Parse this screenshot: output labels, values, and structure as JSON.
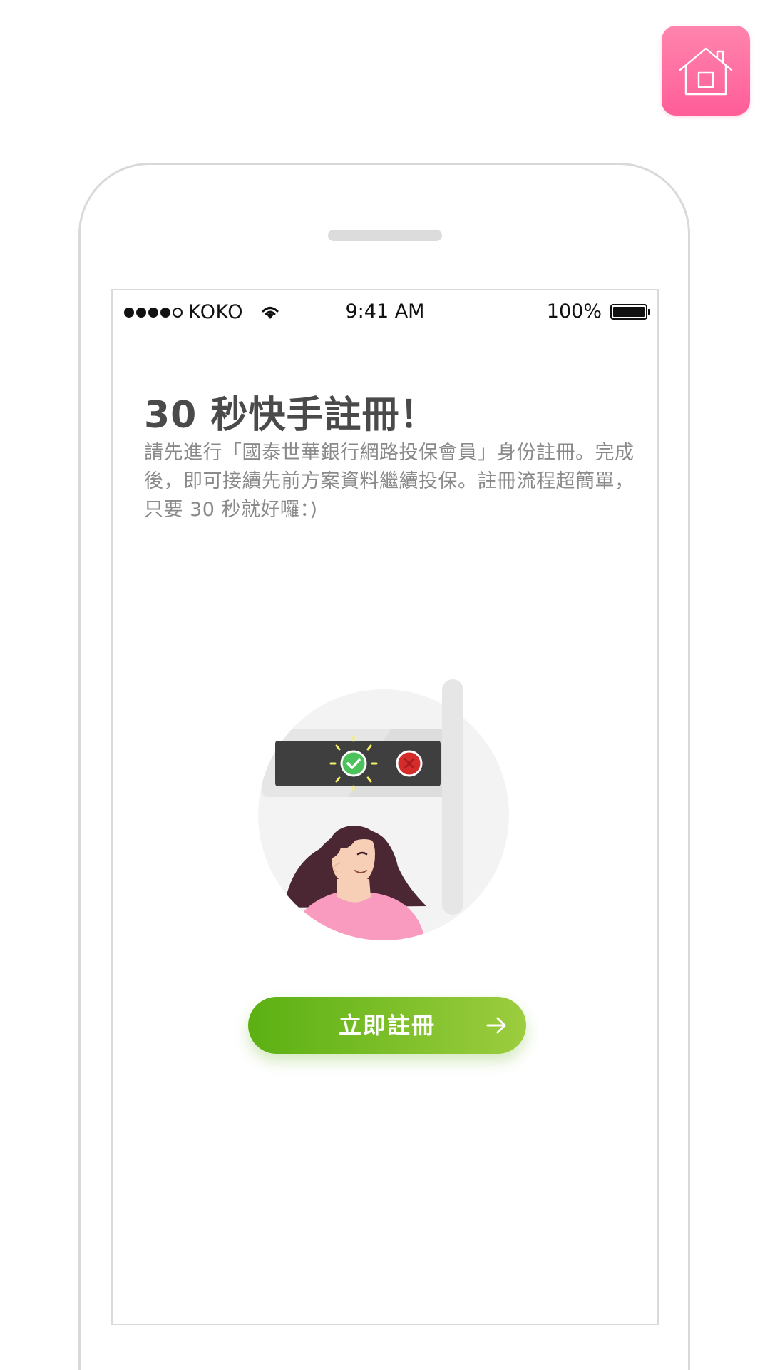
{
  "status_bar": {
    "carrier": "KOKO",
    "time": "9:41 AM",
    "battery_percent": "100%",
    "signal_bars_filled": 4,
    "signal_bars_total": 5,
    "battery_level": 1.0
  },
  "home_button": {
    "icon": "home-icon",
    "color": "#ff6fa3"
  },
  "content": {
    "title": "30 秒快手註冊！",
    "description": "請先進行「國泰世華銀行網路投保會員」身份註冊。完成後，即可接續先前方案資料繼續投保。註冊流程超簡單，只要 30 秒就好囉：)"
  },
  "cta": {
    "label": "立即註冊",
    "icon": "arrow-right-icon",
    "gradient_start": "#5bb012",
    "gradient_end": "#9ccd3f"
  },
  "illustration": {
    "status_ok_icon": "check-icon",
    "status_fail_icon": "x-icon",
    "ok_color": "#4cc35a",
    "fail_color": "#d62b2b",
    "shirt_color": "#f99bbf"
  }
}
